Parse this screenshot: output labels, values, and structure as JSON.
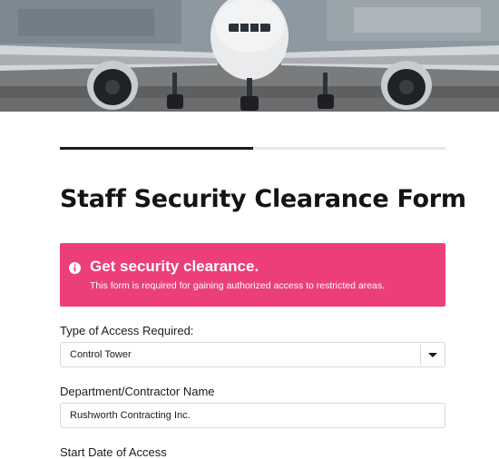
{
  "hero": {
    "image": "airplane-on-tarmac"
  },
  "progress": {
    "fraction": 0.5
  },
  "form": {
    "title": "Staff Security Clearance Form"
  },
  "alert": {
    "icon": "info-icon",
    "color": "#ec3f77",
    "heading": "Get security clearance.",
    "text": "This form is required for gaining authorized access to restricted areas."
  },
  "fields": {
    "access_type": {
      "label": "Type of Access Required:",
      "value": "Control Tower"
    },
    "department": {
      "label": "Department/Contractor Name",
      "value": "Rushworth Contracting Inc."
    },
    "start_date": {
      "label": "Start Date of Access"
    }
  }
}
